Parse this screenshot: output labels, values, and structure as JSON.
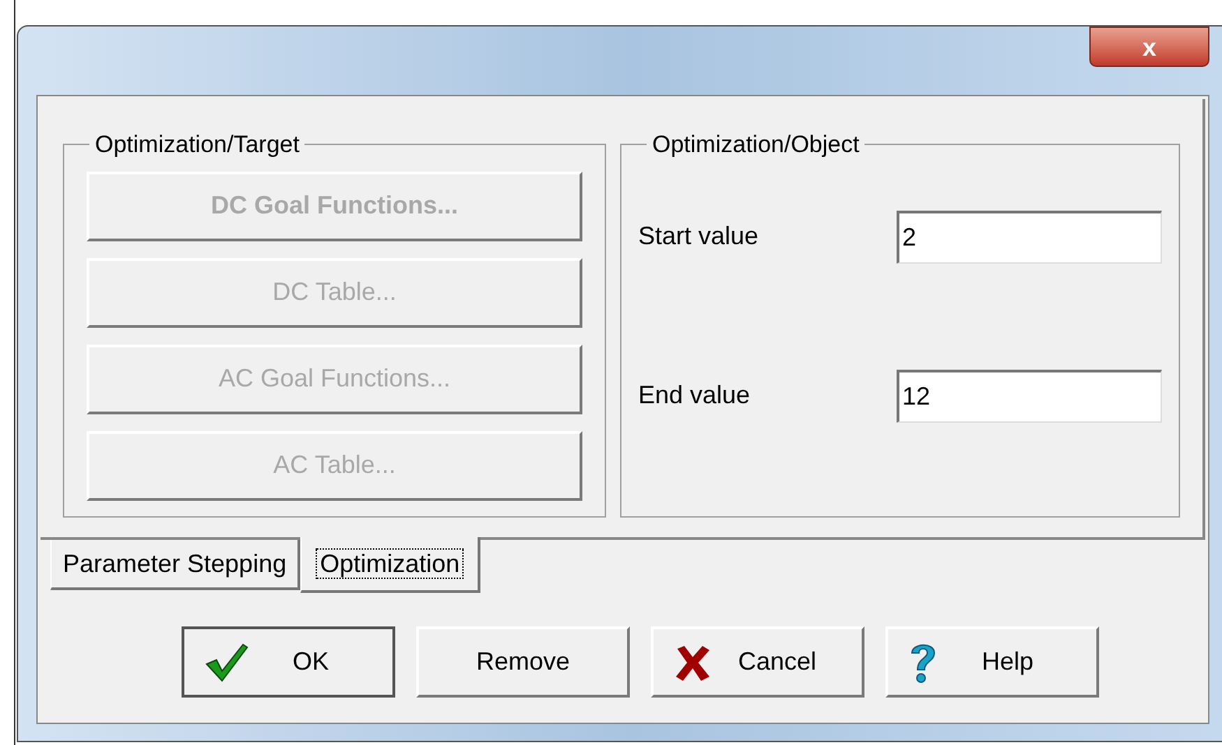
{
  "window": {
    "close_label": "x"
  },
  "target_group": {
    "title": "Optimization/Target",
    "buttons": [
      {
        "label": "DC Goal Functions...",
        "disabled": true,
        "default": true
      },
      {
        "label": "DC Table...",
        "disabled": true,
        "default": false
      },
      {
        "label": "AC Goal Functions...",
        "disabled": true,
        "default": false
      },
      {
        "label": "AC Table...",
        "disabled": true,
        "default": false
      }
    ]
  },
  "object_group": {
    "title": "Optimization/Object",
    "fields": [
      {
        "label": "Start value",
        "value": "2"
      },
      {
        "label": "End value",
        "value": "12"
      }
    ]
  },
  "tabs": [
    {
      "label": "Parameter Stepping",
      "selected": false
    },
    {
      "label": "Optimization",
      "selected": true
    }
  ],
  "buttons": [
    {
      "kind": "ok",
      "label": "OK"
    },
    {
      "kind": "plain",
      "label": "Remove"
    },
    {
      "kind": "cancel",
      "label": "Cancel"
    },
    {
      "kind": "help",
      "label": "Help"
    }
  ]
}
